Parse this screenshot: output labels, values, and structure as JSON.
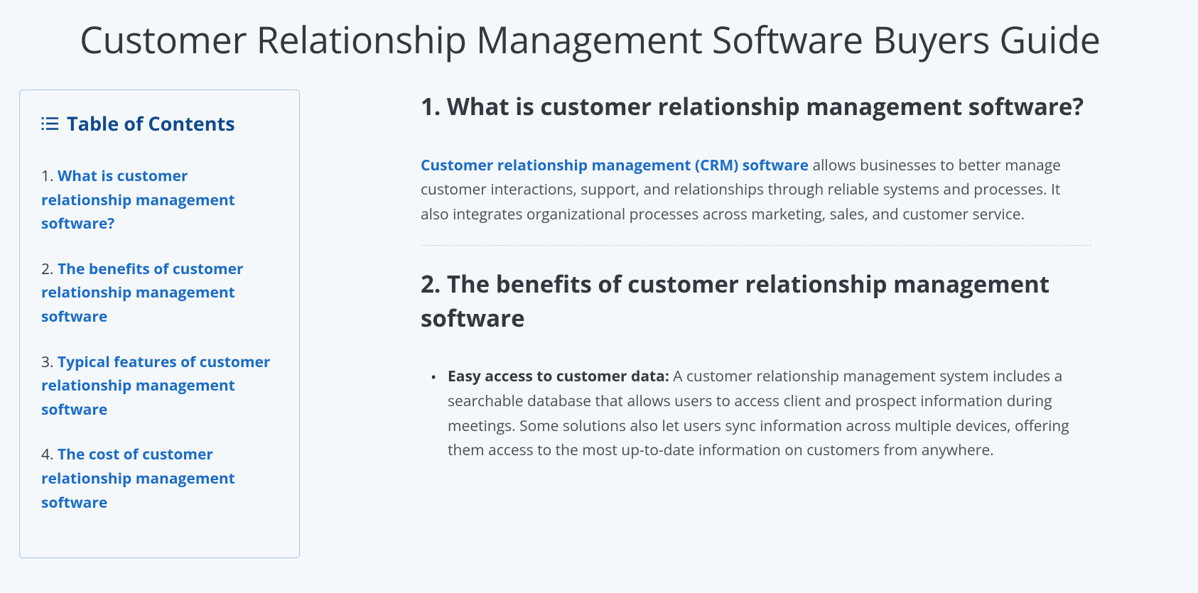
{
  "page_title": "Customer Relationship Management Software Buyers Guide",
  "toc": {
    "title": "Table of Contents",
    "items": [
      {
        "number": "1.",
        "label": "What is customer relationship management software?"
      },
      {
        "number": "2.",
        "label": "The benefits of customer relationship management software"
      },
      {
        "number": "3.",
        "label": "Typical features of customer relationship management software"
      },
      {
        "number": "4.",
        "label": "The cost of customer relationship management software"
      }
    ]
  },
  "sections": {
    "s1": {
      "heading": "1. What is customer relationship management software?",
      "link_text": "Customer relationship management (CRM) software",
      "body_rest": " allows businesses to better manage customer interactions, support, and relationships through reliable systems and processes. It also integrates organizational processes across marketing, sales, and customer service."
    },
    "s2": {
      "heading": "2. The benefits of customer relationship management software",
      "benefits": [
        {
          "label": "Easy access to customer data:",
          "text": " A customer relationship management system includes a searchable database that allows users to access client and prospect information during meetings. Some solutions also let users sync information across multiple devices, offering them access to the most up-to-date information on customers from anywhere."
        }
      ]
    }
  }
}
